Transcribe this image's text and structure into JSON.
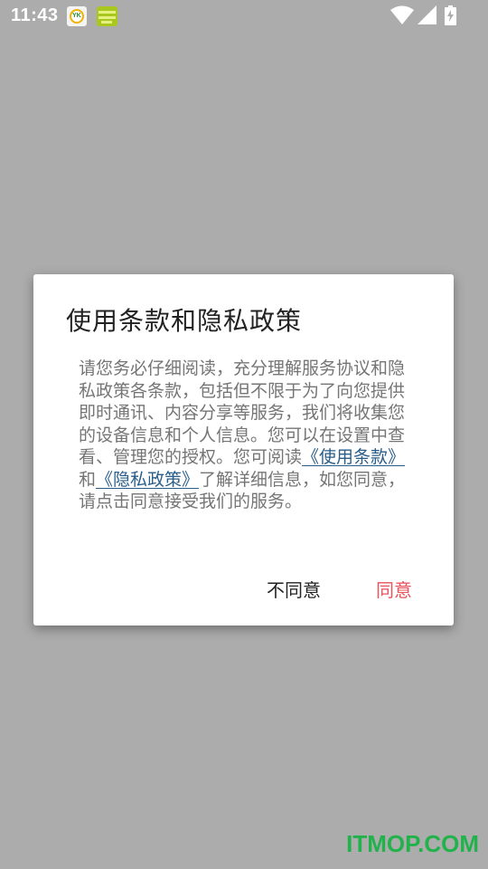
{
  "status_bar": {
    "time": "11:43",
    "notification_icons": [
      "yk-app-icon",
      "green-app-icon"
    ],
    "notification_icon_text": "YK",
    "system_icons": [
      "wifi-icon",
      "signal-icon",
      "battery-charging-icon"
    ]
  },
  "dialog": {
    "title": "使用条款和隐私政策",
    "body_text_1": "请您务必仔细阅读，充分理解服务协议和隐私政策各条款，包括但不限于为了向您提供即时通讯、内容分享等服务，我们将收集您的设备信息和个人信息。您可以在设置中查看、管理您的授权。您可阅读",
    "terms_link": "《使用条款》",
    "body_text_and": "和",
    "privacy_link": "《隐私政策》",
    "body_text_2": "了解详细信息，如您同意，请点击同意接受我们的服务。",
    "disagree_label": "不同意",
    "agree_label": "同意"
  },
  "watermark": "ITMOP.COM",
  "colors": {
    "overlay": "#acacac",
    "agree": "#e8525a",
    "link": "#2a5d8a",
    "watermark": "#22b24c"
  }
}
